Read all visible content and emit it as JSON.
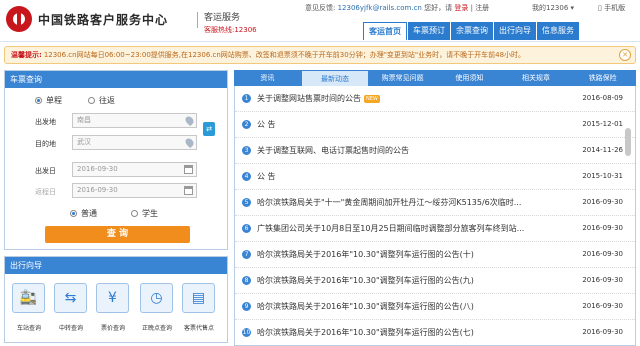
{
  "header": {
    "site_title": "中国铁路客户服务中心",
    "sub_title": "客运服务",
    "hotline": "客服热线:12306",
    "feedback_label": "意见反馈:",
    "feedback_email": "12306yjfk@rails.com.cn",
    "greeting": "您好，请",
    "login": "登录",
    "sep": "|",
    "register": "注册",
    "my12306": "我的12306 ▾",
    "mobile": "手机版"
  },
  "nav": {
    "items": [
      "客运首页",
      "车票预订",
      "余票查询",
      "出行向导",
      "信息服务"
    ]
  },
  "notice": {
    "label": "温馨提示:",
    "text": "12306.cn网站每日06:00~23:00提供服务,在12306.cn网站购票、改签和退票须不晚于开车前30分钟；办理\"变更到站\"业务时，请不晚于开车前48小时。"
  },
  "ticket_query": {
    "title": "车票查询",
    "one_way": "单程",
    "round_trip": "往返",
    "from_label": "出发地",
    "from_value": "南昌",
    "to_label": "目的地",
    "to_value": "武汉",
    "depart_label": "出发日",
    "depart_value": "2016-09-30",
    "return_label": "返程日",
    "return_value": "2016-09-30",
    "normal": "普通",
    "student": "学生",
    "query_button": "查  询"
  },
  "travel_guide": {
    "title": "出行向导",
    "items": [
      "车站查询",
      "中转查询",
      "票价查询",
      "正晚点查询",
      "客票代售点"
    ]
  },
  "news": {
    "tabs": [
      "资讯",
      "最新动态",
      "购票常见问题",
      "使用须知",
      "相关规章",
      "铁路保险"
    ],
    "new_badge": "NEW",
    "items": [
      {
        "no": "1",
        "title": "关于调整网站售票时间的公告",
        "date": "2016-08-09"
      },
      {
        "no": "2",
        "title": "公  告",
        "date": "2015-12-01"
      },
      {
        "no": "3",
        "title": "关于调整互联网、电话订票起售时间的公告",
        "date": "2014-11-26"
      },
      {
        "no": "4",
        "title": "公  告",
        "date": "2015-10-31"
      },
      {
        "no": "5",
        "title": "哈尔滨铁路局关于\"十一\"黄金周期间加开牡丹江～绥芬河K5135/6次临时...",
        "date": "2016-09-30"
      },
      {
        "no": "6",
        "title": "广铁集团公司关于10月8日至10月25日期间临时调整部分旅客列车终到站...",
        "date": "2016-09-30"
      },
      {
        "no": "7",
        "title": "哈尔滨铁路局关于2016年\"10.30\"调整列车运行图的公告(十)",
        "date": "2016-09-30"
      },
      {
        "no": "8",
        "title": "哈尔滨铁路局关于2016年\"10.30\"调整列车运行图的公告(九)",
        "date": "2016-09-30"
      },
      {
        "no": "9",
        "title": "哈尔滨铁路局关于2016年\"10.30\"调整列车运行图的公告(八)",
        "date": "2016-09-30"
      },
      {
        "no": "10",
        "title": "哈尔滨铁路局关于2016年\"10.30\"调整列车运行图的公告(七)",
        "date": "2016-09-30"
      }
    ]
  },
  "colors": {
    "brand_red": "#c8161d",
    "nav_blue": "#2b7bcf",
    "query_orange": "#f08d1c"
  }
}
